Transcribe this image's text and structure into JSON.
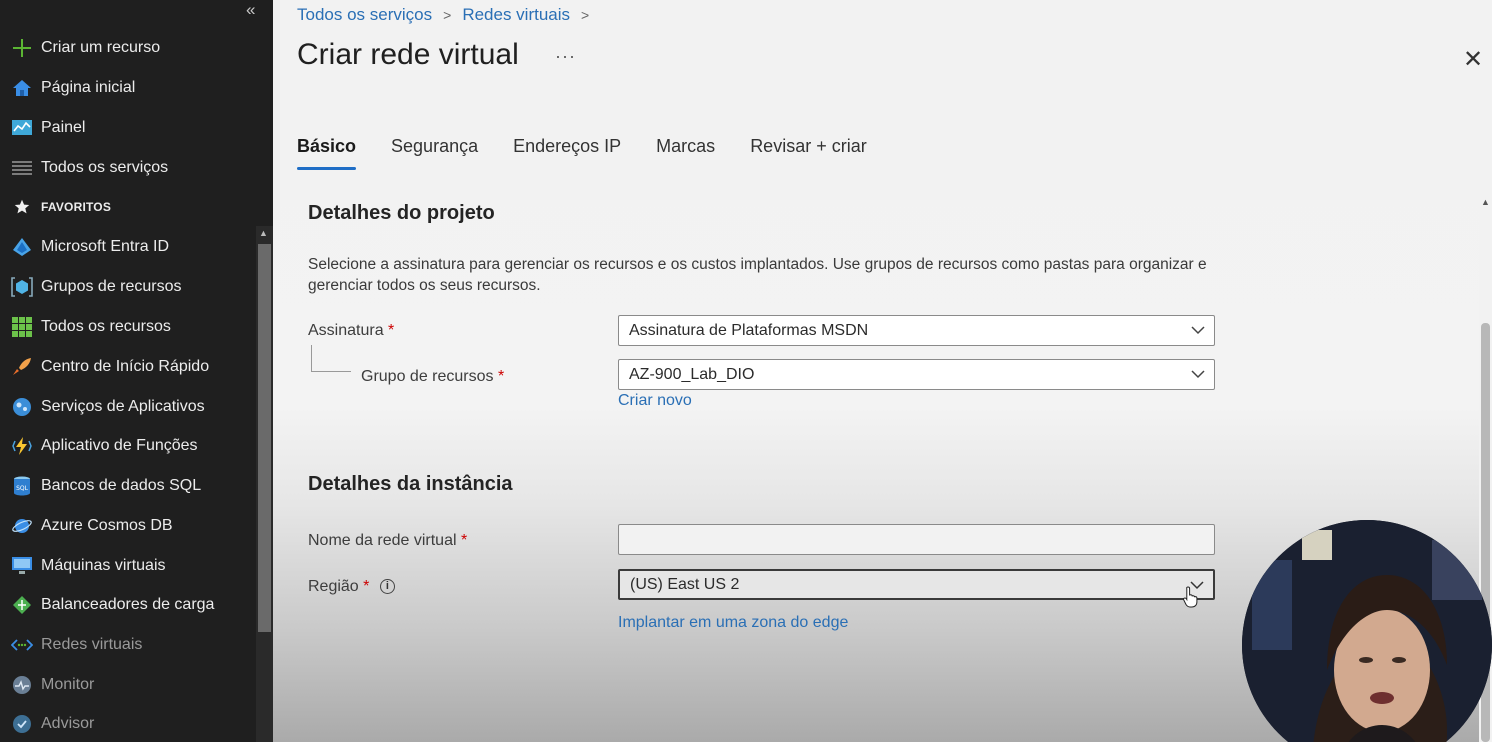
{
  "sidebar": {
    "collapse_icon": "«",
    "items": [
      {
        "label": "Criar um recurso",
        "icon": "plus-icon"
      },
      {
        "label": "Página inicial",
        "icon": "home-icon"
      },
      {
        "label": "Painel",
        "icon": "dashboard-icon"
      },
      {
        "label": "Todos os serviços",
        "icon": "list-icon"
      },
      {
        "label": "FAVORITOS",
        "icon": "star-icon"
      },
      {
        "label": "Microsoft Entra ID",
        "icon": "entra-icon"
      },
      {
        "label": "Grupos de recursos",
        "icon": "resource-group-icon"
      },
      {
        "label": "Todos os recursos",
        "icon": "grid-icon"
      },
      {
        "label": "Centro de Início Rápido",
        "icon": "rocket-icon"
      },
      {
        "label": "Serviços de Aplicativos",
        "icon": "app-service-icon"
      },
      {
        "label": "Aplicativo de Funções",
        "icon": "function-icon"
      },
      {
        "label": "Bancos de dados SQL",
        "icon": "sql-icon"
      },
      {
        "label": "Azure Cosmos DB",
        "icon": "cosmos-icon"
      },
      {
        "label": "Máquinas virtuais",
        "icon": "vm-icon"
      },
      {
        "label": "Balanceadores de carga",
        "icon": "load-balancer-icon"
      },
      {
        "label": "Redes virtuais",
        "icon": "vnet-icon"
      },
      {
        "label": "Monitor",
        "icon": "monitor-icon"
      },
      {
        "label": "Advisor",
        "icon": "advisor-icon"
      }
    ]
  },
  "breadcrumb": {
    "item1": "Todos os serviços",
    "item2": "Redes virtuais",
    "sep": ">"
  },
  "header": {
    "title": "Criar rede virtual",
    "more": "···",
    "close": "✕"
  },
  "tabs": [
    {
      "label": "Básico",
      "active": true
    },
    {
      "label": "Segurança"
    },
    {
      "label": "Endereços IP"
    },
    {
      "label": "Marcas"
    },
    {
      "label": "Revisar + criar"
    }
  ],
  "project": {
    "title": "Detalhes do projeto",
    "description": "Selecione a assinatura para gerenciar os recursos e os custos implantados. Use grupos de recursos como pastas para organizar e gerenciar todos os seus recursos.",
    "subscription_label": "Assinatura",
    "subscription_value": "Assinatura de Plataformas MSDN",
    "resource_group_label": "Grupo de recursos",
    "resource_group_value": "AZ-900_Lab_DIO",
    "create_new": "Criar novo"
  },
  "instance": {
    "title": "Detalhes da instância",
    "name_label": "Nome da rede virtual",
    "name_value": "",
    "region_label": "Região",
    "region_value": "(US) East US 2",
    "edge_link": "Implantar em uma zona do edge"
  },
  "required_mark": "*",
  "info_icon": "i",
  "colors": {
    "accent": "#1f6ec6",
    "link": "#2a6fb5",
    "sidebar_bg": "#1f1f1f"
  }
}
